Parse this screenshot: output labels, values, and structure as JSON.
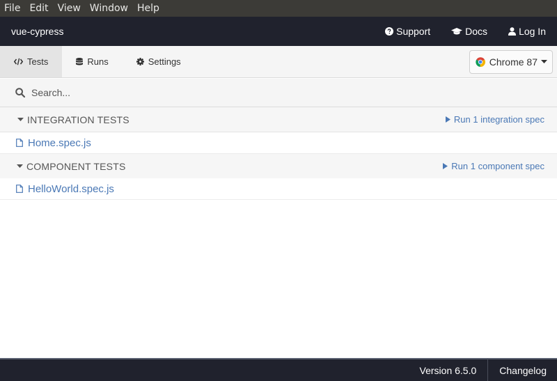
{
  "menubar": {
    "items": [
      "File",
      "Edit",
      "View",
      "Window",
      "Help"
    ]
  },
  "header": {
    "project_name": "vue-cypress",
    "links": [
      {
        "label": "Support",
        "icon": "question-circle-icon"
      },
      {
        "label": "Docs",
        "icon": "graduation-cap-icon"
      },
      {
        "label": "Log In",
        "icon": "user-icon"
      }
    ]
  },
  "tabs": [
    {
      "label": "Tests",
      "icon": "code-icon",
      "active": true
    },
    {
      "label": "Runs",
      "icon": "database-icon",
      "active": false
    },
    {
      "label": "Settings",
      "icon": "gear-icon",
      "active": false
    }
  ],
  "browser": {
    "label": "Chrome 87",
    "icon": "chrome-icon"
  },
  "search": {
    "placeholder": "Search..."
  },
  "spec_groups": [
    {
      "title": "INTEGRATION TESTS",
      "run_label": "Run 1 integration spec",
      "specs": [
        "Home.spec.js"
      ]
    },
    {
      "title": "COMPONENT TESTS",
      "run_label": "Run 1 component spec",
      "specs": [
        "HelloWorld.spec.js"
      ]
    }
  ],
  "footer": {
    "version": "Version 6.5.0",
    "changelog": "Changelog"
  },
  "colors": {
    "header_bg": "#20222d",
    "link_blue": "#4a78b5",
    "menubar_bg": "#3c3b37"
  }
}
